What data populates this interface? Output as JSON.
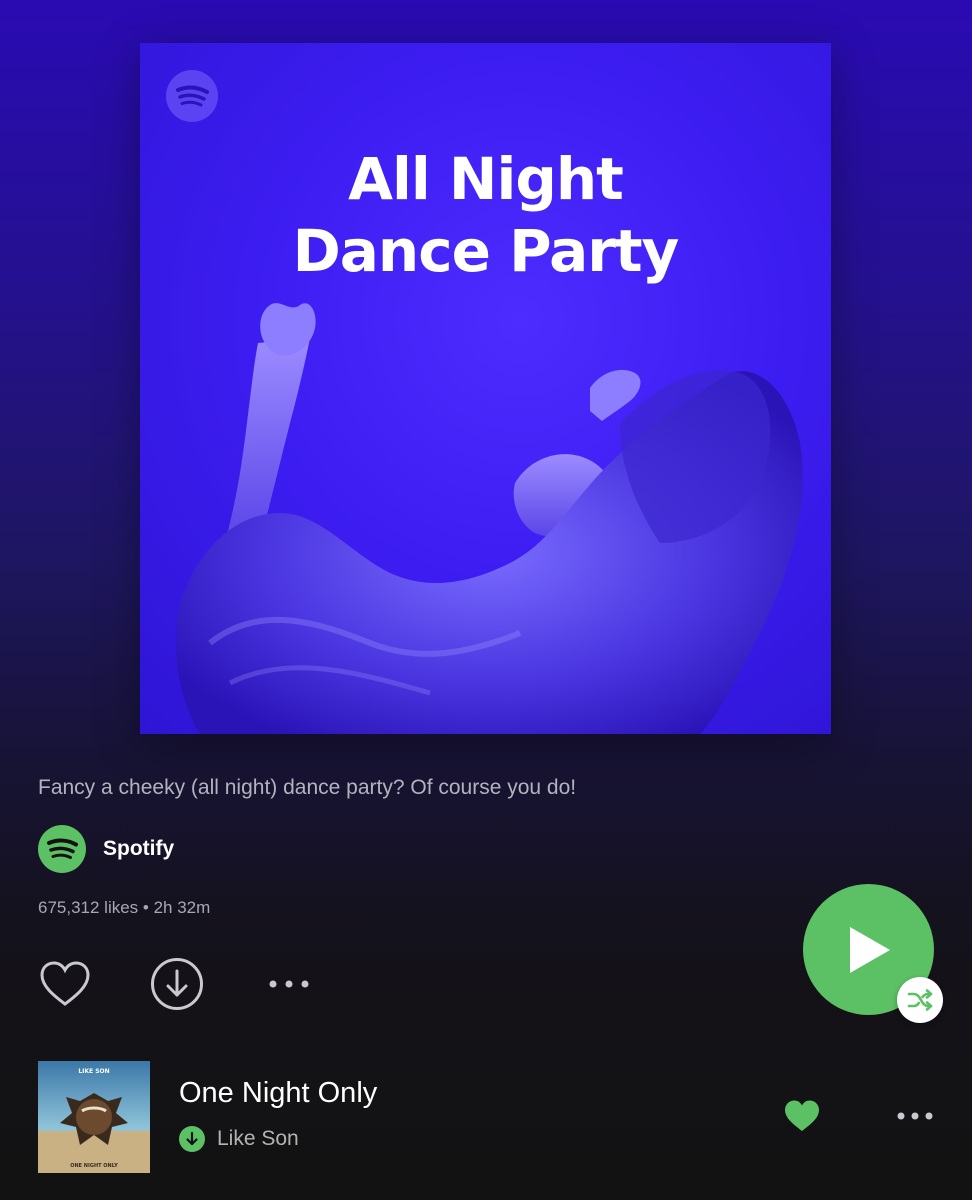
{
  "cover": {
    "title_line1": "All Night",
    "title_line2": "Dance Party",
    "logo_icon": "spotify-logo-icon"
  },
  "playlist": {
    "description": "Fancy a cheeky (all night) dance party? Of course you do!",
    "owner": "Spotify",
    "meta": "675,312 likes • 2h 32m"
  },
  "actions": {
    "like_icon": "heart-outline-icon",
    "download_icon": "download-circle-icon",
    "more_icon": "more-dots-icon",
    "play_icon": "play-icon",
    "shuffle_icon": "shuffle-icon"
  },
  "tracks": [
    {
      "title": "One Night Only",
      "artist": "Like Son",
      "downloaded": true,
      "liked": true,
      "thumb_text_top": "LIKE SON",
      "thumb_text_bottom": "ONE NIGHT ONLY"
    }
  ],
  "colors": {
    "accent_green": "#5cc065",
    "background_top": "#2a0bb3",
    "background_bottom": "#121212",
    "cover_blue": "#3d1df2"
  }
}
